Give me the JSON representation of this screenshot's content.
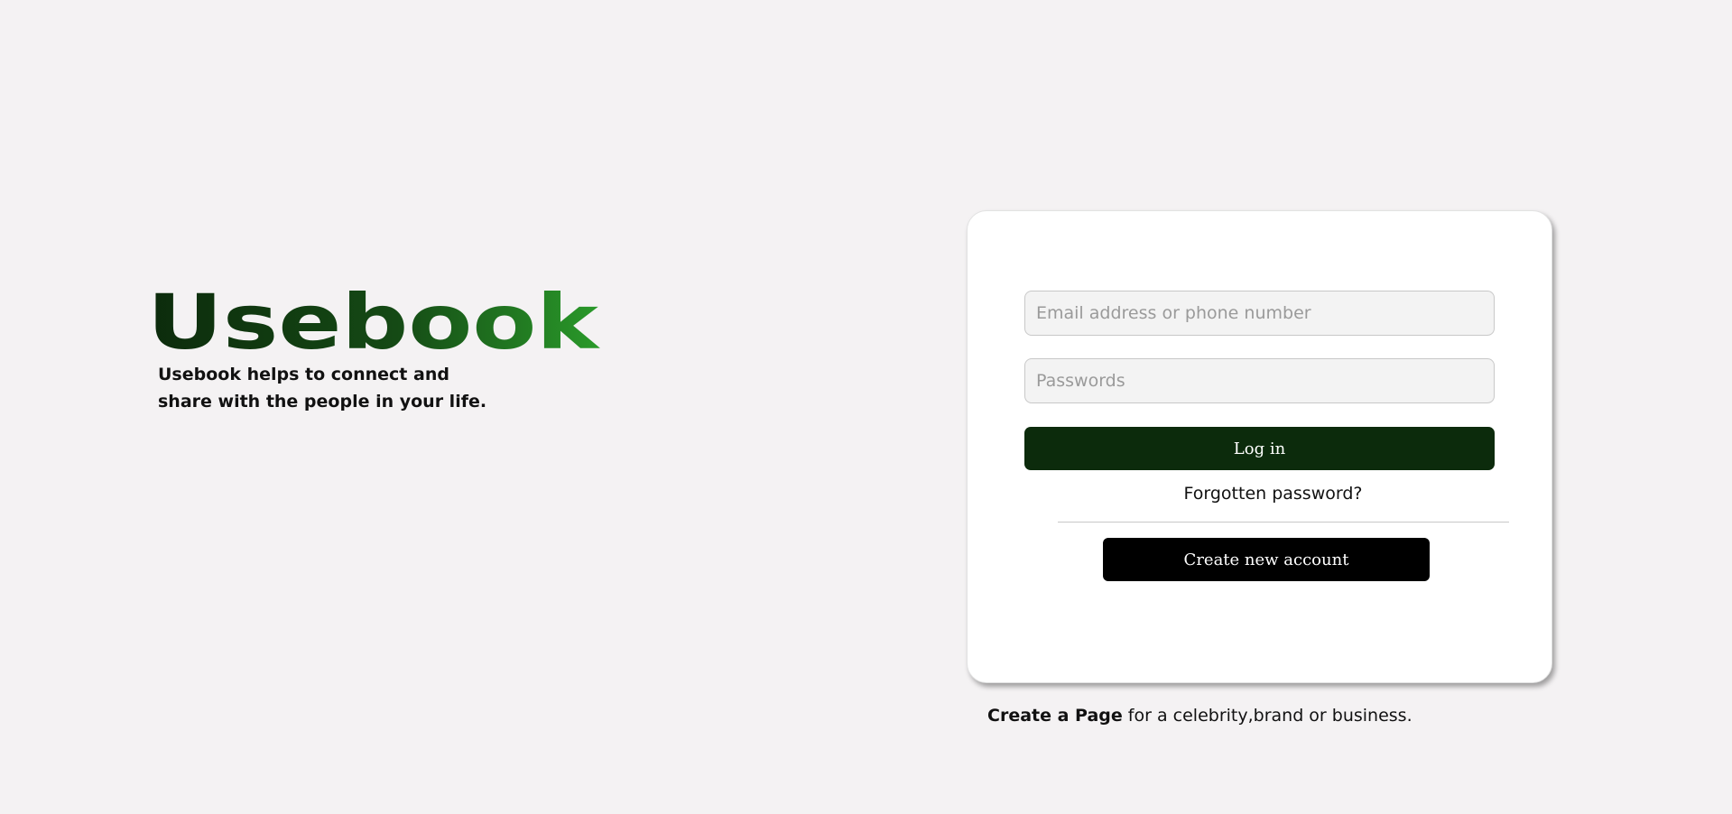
{
  "brand": {
    "logo_text": "Usebook",
    "tagline": "Usebook helps to connect and share with the people in your life.",
    "logo_gradient_start": "#0c2b0c",
    "logo_gradient_end": "#2a9a2a"
  },
  "login": {
    "email_placeholder": "Email address or phone number",
    "email_value": "",
    "password_placeholder": "Passwords",
    "password_value": "",
    "login_label": "Log in",
    "forgot_label": "Forgotten password?",
    "create_account_label": "Create new account",
    "login_button_color": "#0c2b0c",
    "create_button_color": "#000000"
  },
  "footer": {
    "create_page_link": "Create a Page",
    "create_page_suffix": " for a celebrity,brand or business."
  }
}
